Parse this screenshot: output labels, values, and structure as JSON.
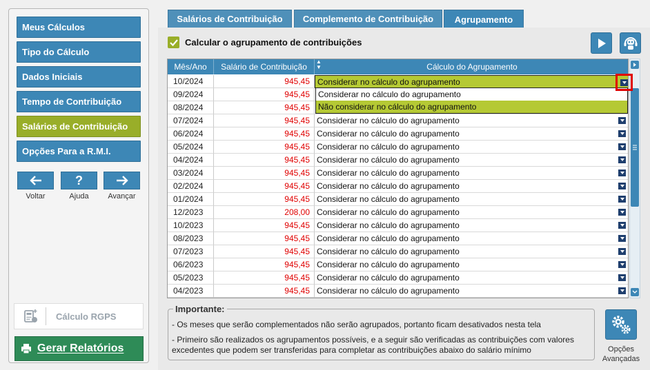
{
  "sidebar": {
    "items": [
      {
        "label": "Meus Cálculos"
      },
      {
        "label": "Tipo do Cálculo"
      },
      {
        "label": "Dados Iniciais"
      },
      {
        "label": "Tempo de Contribuição"
      },
      {
        "label": "Salários de Contribuição",
        "active": true
      },
      {
        "label": "Opções Para a R.M.I."
      }
    ],
    "nav": {
      "back": "Voltar",
      "help": "Ajuda",
      "forward": "Avançar",
      "help_glyph": "?"
    },
    "rgps_label": "Cálculo RGPS",
    "report_button": "Gerar Relatórios"
  },
  "tabs": [
    {
      "label": "Salários de Contribuição"
    },
    {
      "label": "Complemento de Contribuição"
    },
    {
      "label": "Agrupamento",
      "active": true
    }
  ],
  "checkbox_label": "Calcular o agrupamento de contribuições",
  "grid": {
    "headers": [
      "Mês/Ano",
      "Salário de Contribuição",
      "Cálculo do Agrupamento"
    ],
    "rows": [
      {
        "mes": "10/2024",
        "salario": "945,45",
        "calculo": "Considerar no cálculo do agrupamento"
      },
      {
        "mes": "09/2024",
        "salario": "945,45",
        "calculo": "Considerar no cálculo do agrupamento"
      },
      {
        "mes": "08/2024",
        "salario": "945,45",
        "calculo": "Considerar no cálculo do agrupamento"
      },
      {
        "mes": "07/2024",
        "salario": "945,45",
        "calculo": "Considerar no cálculo do agrupamento"
      },
      {
        "mes": "06/2024",
        "salario": "945,45",
        "calculo": "Considerar no cálculo do agrupamento"
      },
      {
        "mes": "05/2024",
        "salario": "945,45",
        "calculo": "Considerar no cálculo do agrupamento"
      },
      {
        "mes": "04/2024",
        "salario": "945,45",
        "calculo": "Considerar no cálculo do agrupamento"
      },
      {
        "mes": "03/2024",
        "salario": "945,45",
        "calculo": "Considerar no cálculo do agrupamento"
      },
      {
        "mes": "02/2024",
        "salario": "945,45",
        "calculo": "Considerar no cálculo do agrupamento"
      },
      {
        "mes": "01/2024",
        "salario": "945,45",
        "calculo": "Considerar no cálculo do agrupamento"
      },
      {
        "mes": "12/2023",
        "salario": "208,00",
        "calculo": "Considerar no cálculo do agrupamento"
      },
      {
        "mes": "10/2023",
        "salario": "945,45",
        "calculo": "Considerar no cálculo do agrupamento"
      },
      {
        "mes": "08/2023",
        "salario": "945,45",
        "calculo": "Considerar no cálculo do agrupamento"
      },
      {
        "mes": "07/2023",
        "salario": "945,45",
        "calculo": "Considerar no cálculo do agrupamento"
      },
      {
        "mes": "06/2023",
        "salario": "945,45",
        "calculo": "Considerar no cálculo do agrupamento"
      },
      {
        "mes": "05/2023",
        "salario": "945,45",
        "calculo": "Considerar no cálculo do agrupamento"
      },
      {
        "mes": "04/2023",
        "salario": "945,45",
        "calculo": "Considerar no cálculo do agrupamento"
      }
    ],
    "dropdown_options": [
      "Considerar no cálculo do agrupamento",
      "Não considerar no cálculo do agrupamento"
    ]
  },
  "important": {
    "title": "Importante:",
    "lines": [
      "- Os meses que serão complementados não serão agrupados, portanto ficam desativados nesta tela",
      "- Primeiro são realizados os agrupamentos possíveis, e a seguir são verificadas as contribuições com valores excedentes que podem ser transferidas para completar as contribuições abaixo do salário mínimo"
    ]
  },
  "advanced_options": {
    "line1": "Opções",
    "line2": "Avançadas"
  },
  "colors": {
    "accent": "#3d87b6",
    "active": "#99ae29",
    "report": "#2e8b57",
    "value": "#e00000"
  }
}
